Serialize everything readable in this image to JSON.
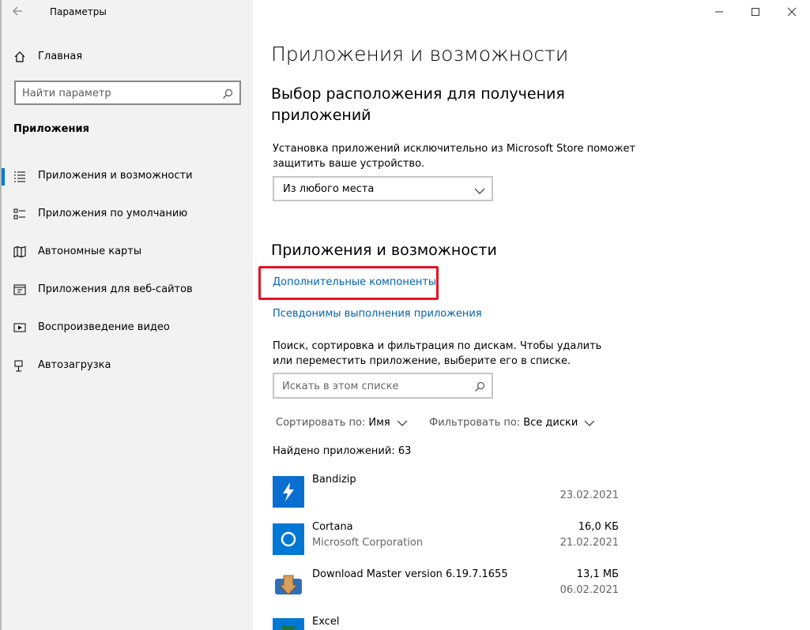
{
  "window": {
    "title": "Параметры"
  },
  "sidebar": {
    "home": "Главная",
    "search_placeholder": "Найти параметр",
    "section": "Приложения",
    "items": [
      {
        "label": "Приложения и возможности",
        "icon": "apps-list-icon",
        "selected": true
      },
      {
        "label": "Приложения по умолчанию",
        "icon": "default-apps-icon",
        "selected": false
      },
      {
        "label": "Автономные карты",
        "icon": "map-icon",
        "selected": false
      },
      {
        "label": "Приложения для веб-сайтов",
        "icon": "web-apps-icon",
        "selected": false
      },
      {
        "label": "Воспроизведение видео",
        "icon": "video-icon",
        "selected": false
      },
      {
        "label": "Автозагрузка",
        "icon": "startup-icon",
        "selected": false
      }
    ]
  },
  "main": {
    "title": "Приложения и возможности",
    "location_heading": "Выбор расположения для получения приложений",
    "location_desc": "Установка приложений исключительно из Microsoft Store поможет защитить ваше устройство.",
    "location_value": "Из любого места",
    "apps_heading": "Приложения и возможности",
    "link_optional": "Дополнительные компоненты",
    "link_aliases": "Псевдонимы выполнения приложения",
    "search_desc": "Поиск, сортировка и фильтрация по дискам. Чтобы удалить или переместить приложение, выберите его в списке.",
    "search_placeholder": "Искать в этом списке",
    "sort_label": "Сортировать по:",
    "sort_value": "Имя",
    "filter_label": "Фильтровать по:",
    "filter_value": "Все диски",
    "found": "Найдено приложений: 63",
    "apps": [
      {
        "name": "Bandizip",
        "publisher": "",
        "size": "",
        "date": "23.02.2021",
        "color": "#0a6ed1"
      },
      {
        "name": "Cortana",
        "publisher": "Microsoft Corporation",
        "size": "16,0 КБ",
        "date": "21.02.2021",
        "color": "#0078d4"
      },
      {
        "name": "Download Master version 6.19.7.1655",
        "publisher": "",
        "size": "13,1 МБ",
        "date": "06.02.2021",
        "color": "#2f6fb8"
      },
      {
        "name": "Excel",
        "publisher": "",
        "size": "",
        "date": "",
        "color": "#0078d4"
      }
    ]
  },
  "colors": {
    "accent": "#0078d4",
    "link": "#0063b1",
    "highlight": "#e81123"
  }
}
